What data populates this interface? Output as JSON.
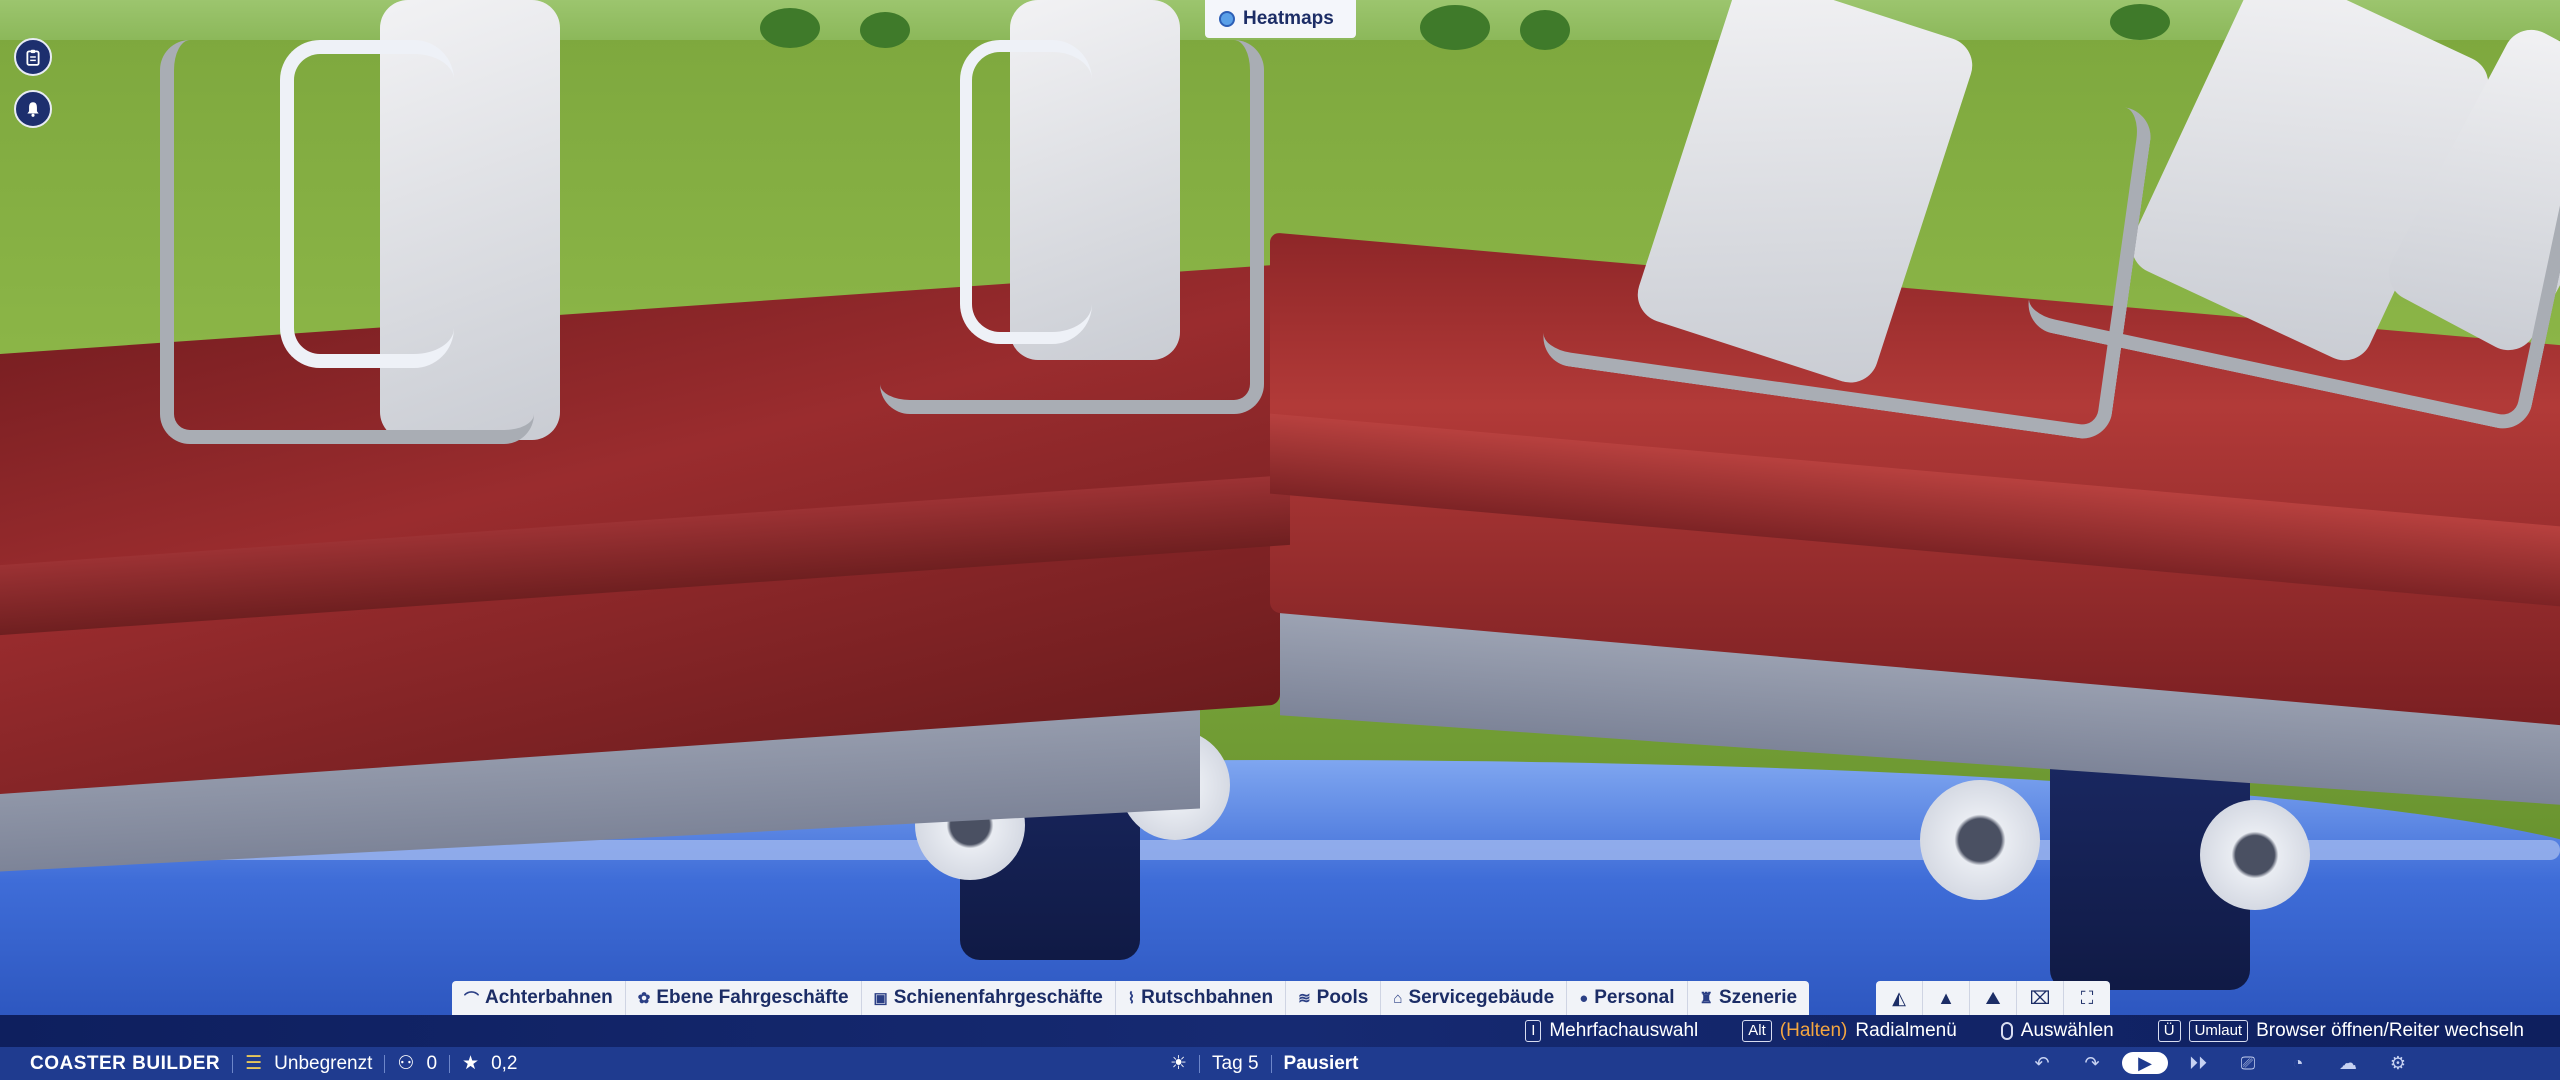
{
  "side_buttons": [
    {
      "icon": "clipboard-icon"
    },
    {
      "icon": "bell-icon"
    }
  ],
  "heatmaps": {
    "label": "Heatmaps",
    "icon": "circle-icon"
  },
  "categories": [
    {
      "icon": "coaster-icon",
      "label": "Achterbahnen"
    },
    {
      "icon": "flat-ride-icon",
      "label": "Ebene Fahrgeschäfte"
    },
    {
      "icon": "track-ride-icon",
      "label": "Schienenfahrgeschäfte"
    },
    {
      "icon": "slide-icon",
      "label": "Rutschbahnen"
    },
    {
      "icon": "pool-icon",
      "label": "Pools"
    },
    {
      "icon": "shop-icon",
      "label": "Servicegebäude"
    },
    {
      "icon": "staff-icon",
      "label": "Personal"
    },
    {
      "icon": "scenery-icon",
      "label": "Szenerie"
    }
  ],
  "tools": [
    {
      "icon": "terrain-icon"
    },
    {
      "icon": "paint-icon"
    },
    {
      "icon": "mountain-icon"
    },
    {
      "icon": "blueprint-icon"
    },
    {
      "icon": "fullscreen-icon"
    }
  ],
  "hints": {
    "multi_key": "I",
    "multi_label": "Mehrfachauswahl",
    "alt_key": "Alt",
    "hold_label": "(Halten)",
    "radial_label": "Radialmenü",
    "select_label": "Auswählen",
    "u_key": "Ü",
    "umlaut_key": "Umlaut",
    "browser_label": "Browser öffnen/Reiter wechseln"
  },
  "status": {
    "mode": "COASTER BUILDER",
    "budget": "Unbegrenzt",
    "guests": "0",
    "rating": "0,2",
    "day": "Tag 5",
    "paused": "Pausiert"
  },
  "controls": [
    {
      "icon": "undo-icon"
    },
    {
      "icon": "redo-icon"
    },
    {
      "icon": "play-icon"
    },
    {
      "icon": "fast-forward-icon"
    },
    {
      "icon": "camera-icon"
    },
    {
      "icon": "photo-mode-icon"
    },
    {
      "icon": "weather-icon"
    },
    {
      "icon": "settings-icon"
    }
  ],
  "colors": {
    "hud_dark": "#1f3b8f",
    "hud_light": "#f1f3f8",
    "accent_orange": "#f4a640"
  }
}
